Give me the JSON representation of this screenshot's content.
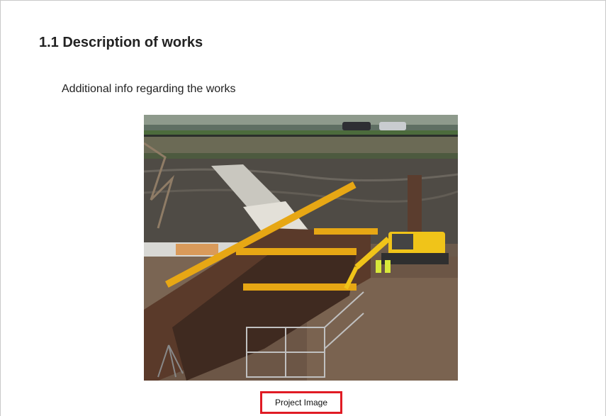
{
  "document": {
    "section_heading": "1.1 Description of works",
    "paragraph": "Additional info regarding the works",
    "figure": {
      "image_name": "project-photo",
      "caption": "Project Image",
      "caption_border_color": "#e01b24"
    }
  }
}
